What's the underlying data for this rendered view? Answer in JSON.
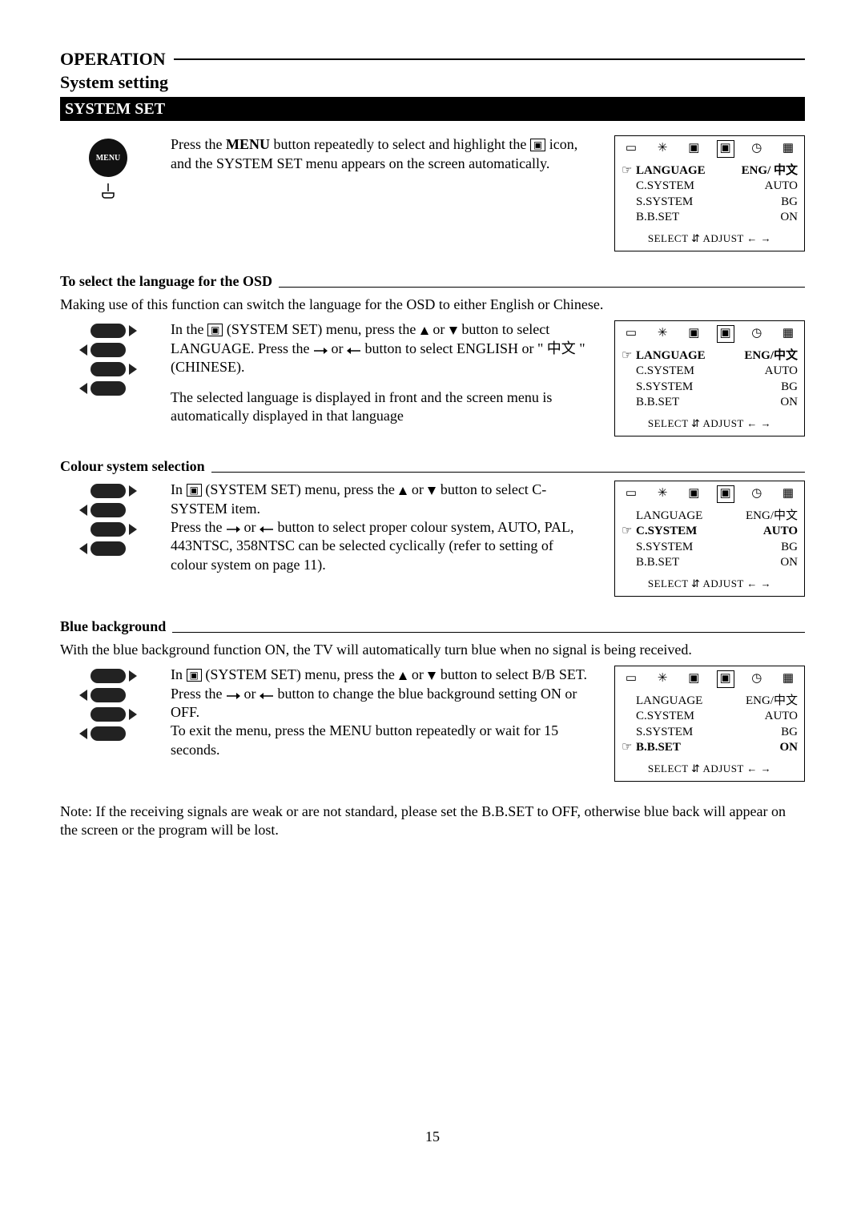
{
  "header": {
    "title": "OPERATION",
    "subtitle": "System setting",
    "bar": "SYSTEM SET"
  },
  "intro": {
    "t1a": "Press the ",
    "t1b": "MENU",
    "t1c": " button repeatedly to select and highlight the ",
    "t1d": " icon, and the SYSTEM SET menu appears on the screen automatically."
  },
  "osd_main": {
    "rows": [
      {
        "l": "LANGUAGE",
        "r": "ENG/ 中文",
        "sel": true
      },
      {
        "l": "C.SYSTEM",
        "r": "AUTO",
        "sel": false
      },
      {
        "l": "S.SYSTEM",
        "r": "BG",
        "sel": false
      },
      {
        "l": "B.B.SET",
        "r": "ON",
        "sel": false
      }
    ],
    "foot": "SELECT ⇵  ADJUST ← →"
  },
  "lang": {
    "head": "To select the language for the OSD",
    "lead": "Making use of this function can switch the language for the OSD to either English or Chinese.",
    "p1a": "In the ",
    "p1b": " (SYSTEM SET) menu, press the ",
    "p1c": " or ",
    "p1d": " button to select LANGUAGE. Press the ",
    "p1e": " or ",
    "p1f": " button to select ENGLISH or \" 中文 \" (CHINESE).",
    "p2": "The selected language is displayed in front and the screen menu is automatically displayed in that language",
    "osd": {
      "rows": [
        {
          "l": "LANGUAGE",
          "r": "ENG/中文",
          "sel": true
        },
        {
          "l": "C.SYSTEM",
          "r": "AUTO",
          "sel": false
        },
        {
          "l": "S.SYSTEM",
          "r": "BG",
          "sel": false
        },
        {
          "l": "B.B.SET",
          "r": "ON",
          "sel": false
        }
      ],
      "foot": "SELECT ⇵  ADJUST ← →"
    }
  },
  "csys": {
    "head": "Colour system selection",
    "p1a": "In ",
    "p1b": " (SYSTEM SET) menu, press the ",
    "p1c": " or ",
    "p1d": " button to select C-SYSTEM item.",
    "p2a": "Press the ",
    "p2b": " or ",
    "p2c": " button to select proper colour system, AUTO, PAL, 443NTSC, 358NTSC can be selected cyclically (refer to setting of colour system on page 11).",
    "osd": {
      "rows": [
        {
          "l": "LANGUAGE",
          "r": "ENG/中文",
          "sel": false
        },
        {
          "l": "C.SYSTEM",
          "r": "AUTO",
          "sel": true
        },
        {
          "l": "S.SYSTEM",
          "r": "BG",
          "sel": false
        },
        {
          "l": "B.B.SET",
          "r": "ON",
          "sel": false
        }
      ],
      "foot": "SELECT ⇵  ADJUST ← →"
    }
  },
  "bb": {
    "head": "Blue background",
    "lead": "With the blue background function ON, the TV will automatically turn blue when no signal is being received.",
    "p1a": "In ",
    "p1b": " (SYSTEM SET) menu, press the ",
    "p1c": " or ",
    "p1d": " button to select B/B SET. Press the ",
    "p1e": " or ",
    "p1f": " button to change the blue background setting ON or OFF.",
    "p2": "To exit the menu, press the MENU button repeatedly or wait for 15 seconds.",
    "osd": {
      "rows": [
        {
          "l": "LANGUAGE",
          "r": "ENG/中文",
          "sel": false
        },
        {
          "l": "C.SYSTEM",
          "r": "AUTO",
          "sel": false
        },
        {
          "l": "S.SYSTEM",
          "r": "BG",
          "sel": false
        },
        {
          "l": "B.B.SET",
          "r": "ON",
          "sel": true
        }
      ],
      "foot": "SELECT ⇵  ADJUST ← →"
    }
  },
  "note": "Note: If the receiving signals are weak or are not standard, please set the B.B.SET to OFF, otherwise blue back will appear on the screen or the program will be lost.",
  "pagenum": "15",
  "icons": {
    "system": "▣",
    "osd_row": [
      "📺",
      "✨",
      "📷",
      "▣",
      "⏲",
      "🗂"
    ]
  }
}
